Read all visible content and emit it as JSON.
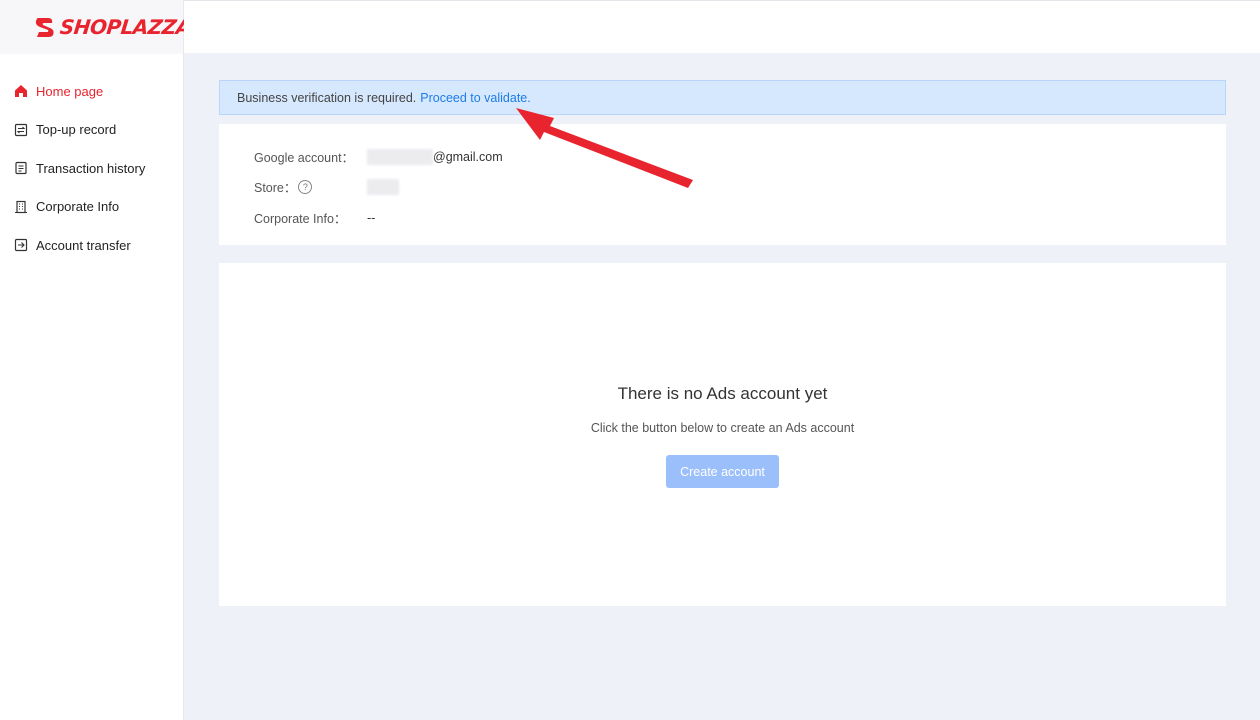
{
  "brand": {
    "name": "SHOPLAZZA",
    "color": "#e8242f"
  },
  "sidebar": {
    "items": [
      {
        "label": "Home page",
        "icon": "home-icon",
        "active": true
      },
      {
        "label": "Top-up record",
        "icon": "topup-icon"
      },
      {
        "label": "Transaction history",
        "icon": "document-icon"
      },
      {
        "label": "Corporate Info",
        "icon": "building-icon"
      },
      {
        "label": "Account transfer",
        "icon": "transfer-icon"
      }
    ]
  },
  "banner": {
    "text": "Business verification is required.",
    "link": "Proceed to validate."
  },
  "info": {
    "google_label": "Google account：",
    "google_value": "@gmail.com",
    "store_label": "Store：",
    "corporate_label": "Corporate Info：",
    "corporate_value": "--"
  },
  "empty": {
    "title": "There is no Ads account yet",
    "subtitle": "Click the button below to create an Ads account",
    "button": "Create account"
  },
  "colors": {
    "accent": "#e8242f",
    "link": "#1e7ce8",
    "button": "#9bbffb",
    "banner_bg": "#d6e8fd",
    "page_bg": "#eef1f8"
  }
}
